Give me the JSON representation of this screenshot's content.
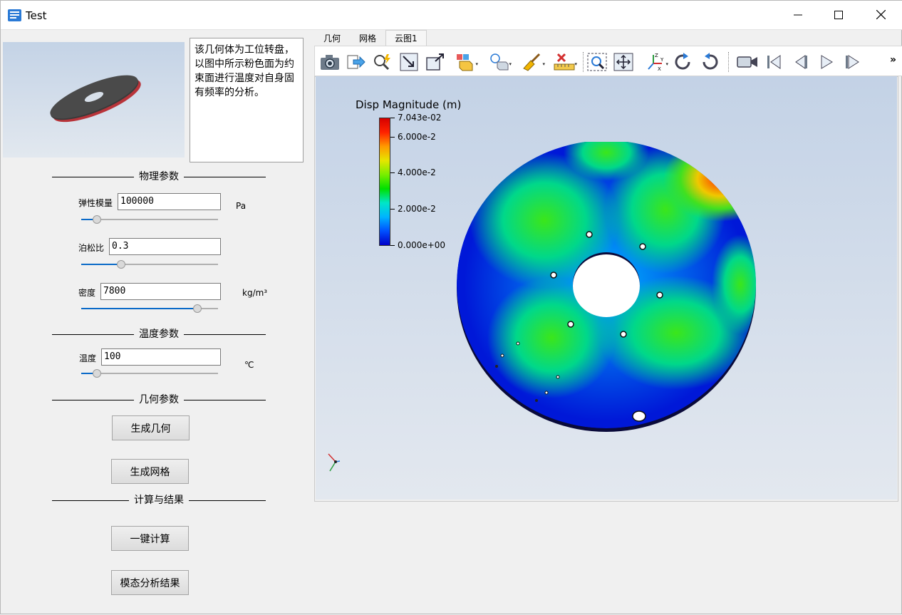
{
  "window": {
    "title": "Test",
    "controls": {
      "minimize": "minimize-icon",
      "maximize": "maximize-icon",
      "close": "close-icon"
    }
  },
  "left_panel": {
    "description": "该几何体为工位转盘，以图中所示粉色面为约束面进行温度对自身固有频率的分析。",
    "sections": {
      "physics": "物理参数",
      "temperature": "温度参数",
      "geometry": "几何参数",
      "compute": "计算与结果"
    },
    "params": {
      "elastic_modulus": {
        "label": "弹性模量",
        "value": "100000",
        "unit": "Pa",
        "slider": 0.09
      },
      "poisson_ratio": {
        "label": "泊松比",
        "value": "0.3",
        "slider": 0.28
      },
      "density": {
        "label": "密度",
        "value": "7800",
        "unit": "kg/m³",
        "slider": 0.87
      },
      "temperature": {
        "label": "温度",
        "value": "100",
        "unit": "℃",
        "slider": 0.09
      }
    },
    "buttons": {
      "generate_geometry": "生成几何",
      "generate_mesh": "生成网格",
      "one_click_compute": "一键计算",
      "modal_results": "模态分析结果"
    }
  },
  "right_panel": {
    "tabs": [
      "几何",
      "网格",
      "云图1"
    ],
    "active_tab": 2,
    "toolbar_icons": [
      "camera-icon",
      "export-icon",
      "probe-icon",
      "fit-view-icon",
      "frame-icon",
      "render-mode-icon",
      "light-icon",
      "clean-icon",
      "ruler-icon",
      "zoom-box-icon",
      "pan-fit-icon",
      "axes-icon",
      "rotate-cw-icon",
      "rotate-ccw-icon",
      "video-camera-icon",
      "first-frame-icon",
      "prev-frame-icon",
      "play-icon",
      "next-frame-icon"
    ],
    "more": "»",
    "colorbar": {
      "title": "Disp Magnitude (m)",
      "labels": [
        "7.043e-02",
        "6.000e-2",
        "4.000e-2",
        "2.000e-2",
        "0.000e+00"
      ],
      "colors": {
        "max": "#d60000",
        "mid": "#00e000",
        "min": "#0000c8"
      }
    }
  }
}
